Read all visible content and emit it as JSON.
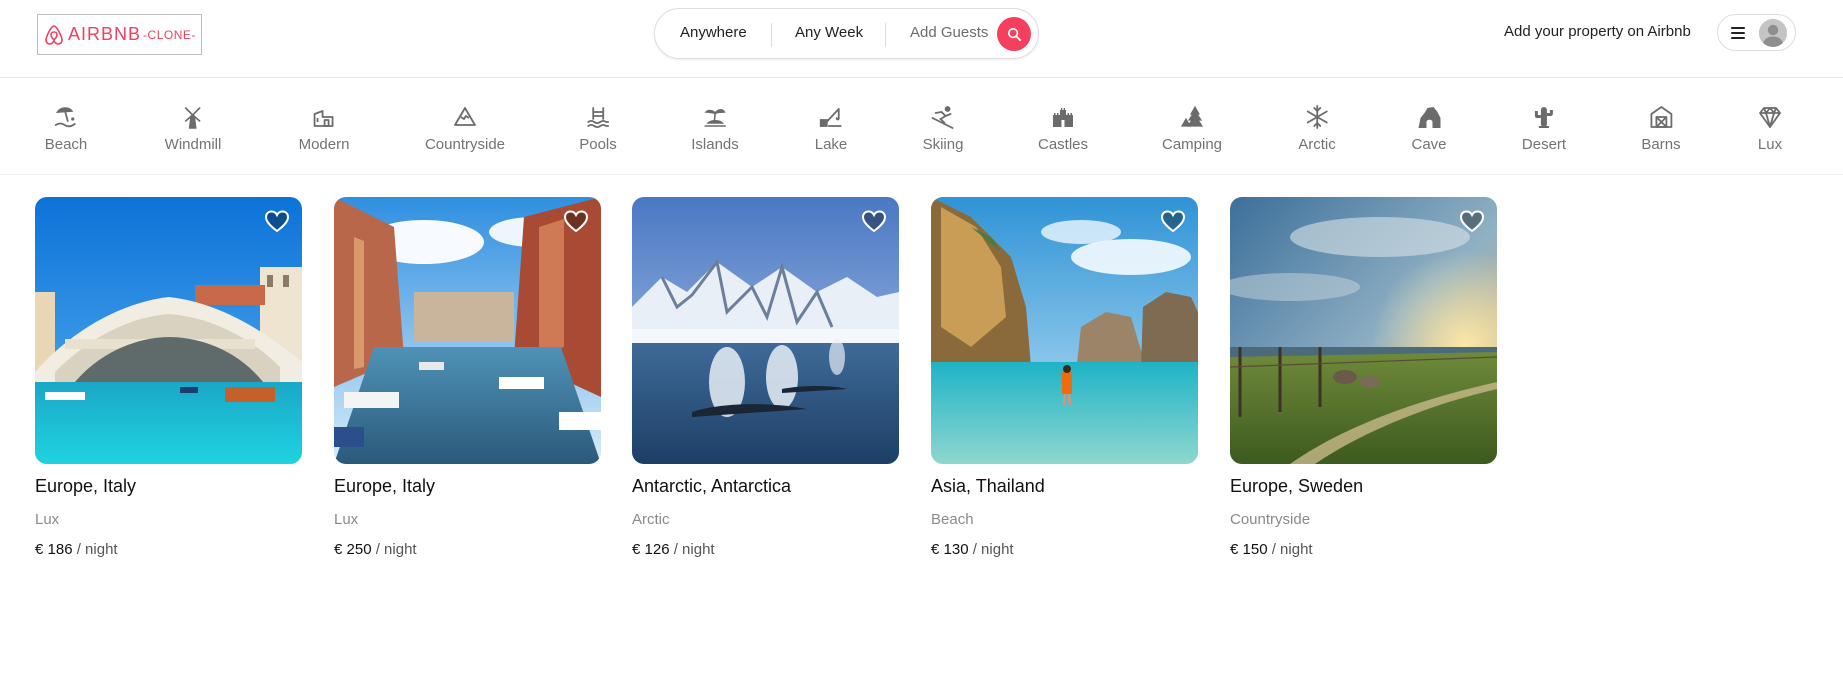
{
  "brand": {
    "name": "AIRBNB",
    "suffix": "-CLONE-",
    "accent": "#f43f5e",
    "logo_icon": "airbnb-logo-icon"
  },
  "search": {
    "where": "Anywhere",
    "when": "Any Week",
    "who": "Add Guests",
    "button_icon": "search-icon"
  },
  "header": {
    "host_link": "Add your property on Airbnb",
    "menu_icon": "hamburger-menu-icon",
    "avatar_icon": "user-avatar-icon"
  },
  "categories": [
    {
      "label": "Beach",
      "icon": "beach-icon"
    },
    {
      "label": "Windmill",
      "icon": "windmill-icon"
    },
    {
      "label": "Modern",
      "icon": "modern-icon"
    },
    {
      "label": "Countryside",
      "icon": "mountain-icon"
    },
    {
      "label": "Pools",
      "icon": "pool-icon"
    },
    {
      "label": "Islands",
      "icon": "island-icon"
    },
    {
      "label": "Lake",
      "icon": "fishing-icon"
    },
    {
      "label": "Skiing",
      "icon": "skiing-icon"
    },
    {
      "label": "Castles",
      "icon": "castle-icon"
    },
    {
      "label": "Camping",
      "icon": "camping-icon"
    },
    {
      "label": "Arctic",
      "icon": "snowflake-icon"
    },
    {
      "label": "Cave",
      "icon": "cave-icon"
    },
    {
      "label": "Desert",
      "icon": "cactus-icon"
    },
    {
      "label": "Barns",
      "icon": "barn-icon"
    },
    {
      "label": "Lux",
      "icon": "diamond-icon"
    }
  ],
  "listings": [
    {
      "location": "Europe, Italy",
      "category": "Lux",
      "price": "€ 186",
      "unit": "/ night",
      "image": "venice-rialto-bridge-photo"
    },
    {
      "location": "Europe, Italy",
      "category": "Lux",
      "price": "€ 250",
      "unit": "/ night",
      "image": "venice-canal-boats-photo"
    },
    {
      "location": "Antarctic, Antarctica",
      "category": "Arctic",
      "price": "€ 126",
      "unit": "/ night",
      "image": "antarctic-whales-photo"
    },
    {
      "location": "Asia, Thailand",
      "category": "Beach",
      "price": "€ 130",
      "unit": "/ night",
      "image": "thailand-bay-cliffs-photo"
    },
    {
      "location": "Europe, Sweden",
      "category": "Countryside",
      "price": "€ 150",
      "unit": "/ night",
      "image": "sweden-countryside-sunset-photo"
    }
  ]
}
